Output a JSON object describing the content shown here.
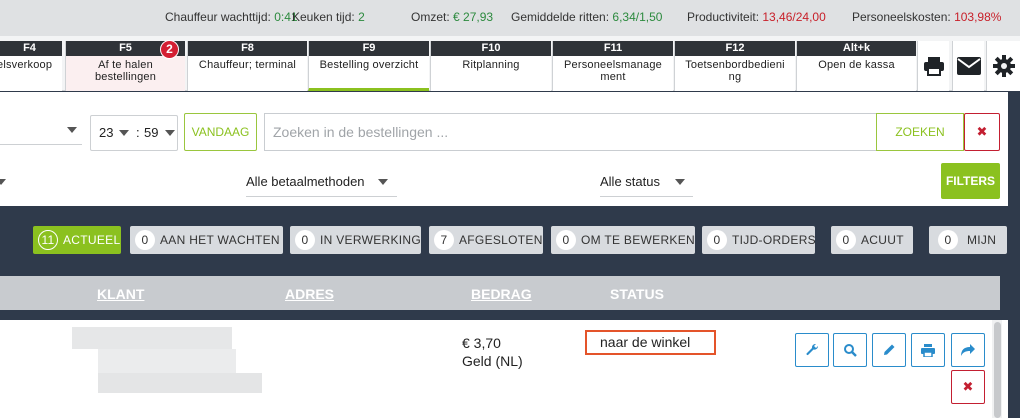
{
  "stats": [
    {
      "label": "Chauffeur wachttijd:",
      "value": "0:41",
      "tone": "green"
    },
    {
      "label": "Keuken tijd:",
      "value": "2",
      "tone": "green"
    },
    {
      "label": "Omzet:",
      "value": "€ 27,93",
      "tone": "green"
    },
    {
      "label": "Gemiddelde ritten:",
      "value": "6,34/1,50",
      "tone": "green"
    },
    {
      "label": "Productiviteit:",
      "value": "13,46/24,00",
      "tone": "red"
    },
    {
      "label": "Personeelskosten:",
      "value": "103,98%",
      "tone": "red"
    }
  ],
  "tabs": [
    {
      "key": "F4",
      "name": "elsverkoop"
    },
    {
      "key": "F5",
      "name": "Af te halen bestellingen",
      "badge": "2"
    },
    {
      "key": "F8",
      "name": "Chauffeur; terminal"
    },
    {
      "key": "F9",
      "name": "Bestelling overzicht"
    },
    {
      "key": "F10",
      "name": "Ritplanning"
    },
    {
      "key": "F11",
      "name": "Personeelsmanage ment"
    },
    {
      "key": "F12",
      "name": "Toetsenbordbedieni ng"
    },
    {
      "key": "Alt+k",
      "name": "Open de kassa"
    }
  ],
  "toolbar_icons": [
    "printer-icon",
    "mail-icon",
    "settings-icon"
  ],
  "filters": {
    "hour": "23",
    "minute": "59",
    "time_separator": ":",
    "today_label": "VANDAAG",
    "search_placeholder": "Zoeken in de bestellingen ...",
    "search_label": "ZOEKEN",
    "clear_label": "✖",
    "payment_method": "Alle betaalmethoden",
    "status": "Alle status",
    "filters_label": "FILTERS"
  },
  "status_pills": [
    {
      "count": "11",
      "label": "ACTUEEL"
    },
    {
      "count": "0",
      "label": "AAN HET WACHTEN"
    },
    {
      "count": "0",
      "label": "IN VERWERKING"
    },
    {
      "count": "7",
      "label": "AFGESLOTEN"
    },
    {
      "count": "0",
      "label": "OM TE BEWERKEN"
    },
    {
      "count": "0",
      "label": "TIJD-ORDERS"
    },
    {
      "count": "0",
      "label": "ACUUT"
    },
    {
      "count": "0",
      "label": "MIJN"
    }
  ],
  "table": {
    "columns": [
      "KLANT",
      "ADRES",
      "BEDRAG",
      "STATUS"
    ],
    "rows": [
      {
        "amount": "€ 3,70",
        "payment": "Geld (NL)",
        "status": "naar de winkel"
      }
    ]
  },
  "row_actions": [
    "wrench-icon",
    "search-icon",
    "pencil-icon",
    "printer-icon",
    "forward-icon",
    "delete-icon"
  ],
  "colors": {
    "accent_green": "#8bc11f",
    "danger_red": "#c31f31",
    "action_blue": "#2a8ccb",
    "status_highlight": "#e4542a"
  }
}
